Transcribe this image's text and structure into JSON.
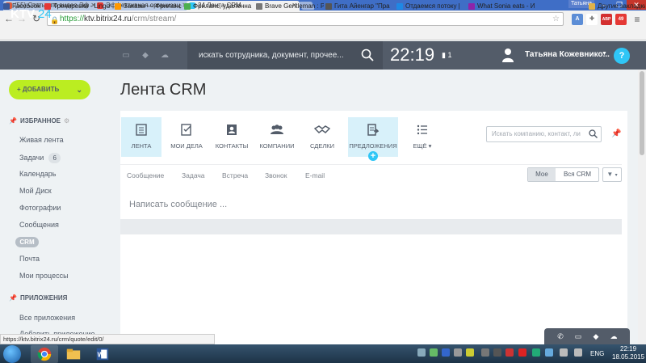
{
  "browser": {
    "tabs": [
      {
        "title": "(55) Статья по видео Эф"
      },
      {
        "title": "Эффективная организац"
      },
      {
        "title": "24 Лента CRM"
      }
    ],
    "user_pill": "Татьяна",
    "window_controls": {
      "minimize": "–",
      "maximize": "❐",
      "close": "✕"
    },
    "url": {
      "scheme": "https://",
      "host": "ktv.bitrix24.ru",
      "path": "/crm/stream/"
    },
    "bookmarks": [
      {
        "label": "Facebook",
        "color": "#3b5998"
      },
      {
        "label": "Тренировки - Lingu",
        "color": "#e53935"
      },
      {
        "label": "Заказы — Фриланс",
        "color": "#ff9800"
      },
      {
        "label": "Фриланс, удаленна",
        "color": "#4caf50"
      },
      {
        "label": "Brave Gentleman : P",
        "color": "#777777"
      },
      {
        "label": "Гита Айенгар \"Пра",
        "color": "#555555"
      },
      {
        "label": "Отдаемся потоку |",
        "color": "#1e88e5"
      },
      {
        "label": "What Sonia eats - И",
        "color": "#8e24aa"
      }
    ],
    "other_bookmarks": "Другие закладки",
    "extensions": [
      "A",
      "ABP",
      "49"
    ]
  },
  "header": {
    "logo_text": "KTV",
    "logo_num": "24",
    "search_placeholder": "искать сотрудника, документ, прочее...",
    "clock": "22:19",
    "flag_count": "1",
    "username": "Татьяна Кожевнико...",
    "help": "?"
  },
  "sidebar": {
    "add_label": "ДОБАВИТЬ",
    "favorites_title": "ИЗБРАННОЕ",
    "items": [
      {
        "label": "Живая лента"
      },
      {
        "label": "Задачи",
        "badge": "6"
      },
      {
        "label": "Календарь"
      },
      {
        "label": "Мой Диск"
      },
      {
        "label": "Фотографии"
      },
      {
        "label": "Сообщения"
      },
      {
        "label": "CRM"
      },
      {
        "label": "Почта"
      },
      {
        "label": "Мои процессы"
      }
    ],
    "apps_title": "ПРИЛОЖЕНИЯ",
    "apps_items": [
      {
        "label": "Все приложения"
      },
      {
        "label": "Добавить приложение"
      }
    ]
  },
  "main": {
    "title": "Лента CRM",
    "toolbar": [
      {
        "label": "ЛЕНТА"
      },
      {
        "label": "МОИ ДЕЛА"
      },
      {
        "label": "КОНТАКТЫ"
      },
      {
        "label": "КОМПАНИИ"
      },
      {
        "label": "СДЕЛКИ"
      },
      {
        "label": "ПРЕДЛОЖЕНИЯ"
      },
      {
        "label": "ЕЩЁ ▾"
      }
    ],
    "search_placeholder": "Искать компанию, контакт, ли",
    "subtabs": [
      "Сообщение",
      "Задача",
      "Встреча",
      "Звонок",
      "E-mail"
    ],
    "toggle": {
      "mine": "Мое",
      "all": "Вся CRM"
    },
    "composer_placeholder": "Написать сообщение ..."
  },
  "status_url": "https://ktv.bitrix24.ru/crm/quote/edit/0/",
  "taskbar": {
    "lang": "ENG",
    "time": "22:19",
    "date": "18.05.2015"
  }
}
